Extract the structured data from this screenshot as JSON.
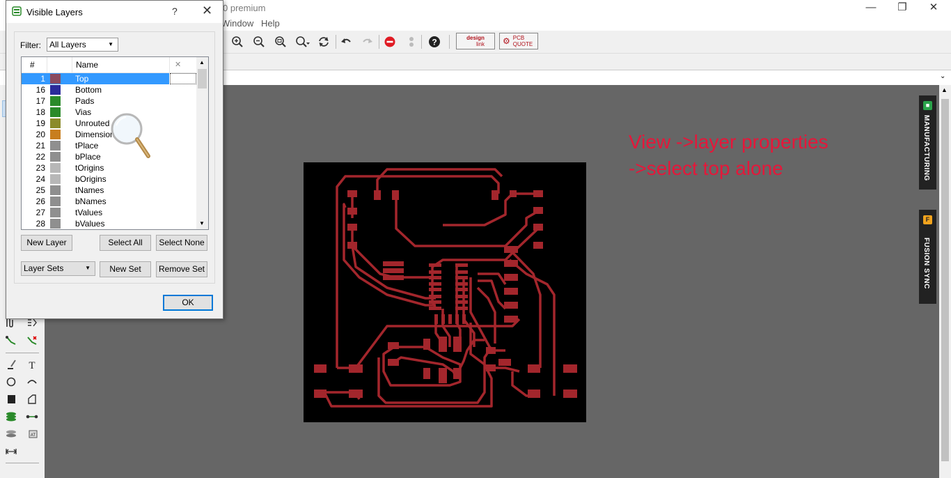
{
  "app": {
    "title": "0 premium"
  },
  "menu": {
    "window": "Window",
    "help": "Help"
  },
  "toolbar": {
    "icons": [
      "zoom-in-icon",
      "zoom-out-icon",
      "zoom-fit-icon",
      "zoom-select-icon",
      "refresh-icon",
      "undo-icon",
      "redo-icon",
      "stop-icon",
      "pause-icon",
      "help-icon"
    ],
    "design_link": [
      "design",
      "link"
    ],
    "pcb_quote": [
      "PCB",
      "QUOTE"
    ]
  },
  "annotation": {
    "line1": "View ->layer properties",
    "line2": "->select top alone"
  },
  "side_tabs": {
    "manufacturing": "MANUFACTURING",
    "fusion_sync": "FUSION SYNC"
  },
  "dialog": {
    "title": "Visible Layers",
    "help": "?",
    "close": "✕",
    "filter_label": "Filter:",
    "filter_value": "All Layers",
    "columns": {
      "num": "#",
      "name": "Name",
      "clear": "✕"
    },
    "layers": [
      {
        "num": "1",
        "name": "Top",
        "color": "#8b4a5e",
        "selected": true
      },
      {
        "num": "16",
        "name": "Bottom",
        "color": "#2b2b9a"
      },
      {
        "num": "17",
        "name": "Pads",
        "color": "#2a8a2a"
      },
      {
        "num": "18",
        "name": "Vias",
        "color": "#2a8a2a"
      },
      {
        "num": "19",
        "name": "Unrouted",
        "color": "#8b8b2a"
      },
      {
        "num": "20",
        "name": "Dimension",
        "color": "#c87e1e"
      },
      {
        "num": "21",
        "name": "tPlace",
        "color": "#8f8f8f"
      },
      {
        "num": "22",
        "name": "bPlace",
        "color": "#8f8f8f"
      },
      {
        "num": "23",
        "name": "tOrigins",
        "color": "#b7b7b7"
      },
      {
        "num": "24",
        "name": "bOrigins",
        "color": "#b7b7b7"
      },
      {
        "num": "25",
        "name": "tNames",
        "color": "#8f8f8f"
      },
      {
        "num": "26",
        "name": "bNames",
        "color": "#8f8f8f"
      },
      {
        "num": "27",
        "name": "tValues",
        "color": "#8f8f8f"
      },
      {
        "num": "28",
        "name": "bValues",
        "color": "#8f8f8f"
      }
    ],
    "buttons": {
      "new_layer": "New Layer",
      "select_all": "Select All",
      "select_none": "Select None",
      "layer_sets": "Layer Sets",
      "new_set": "New Set",
      "remove_set": "Remove Set",
      "ok": "OK"
    }
  },
  "colors": {
    "trace": "#a3262c",
    "board": "#000000",
    "canvas": "#666666",
    "selection": "#3399ff",
    "annotation": "#e5173a"
  }
}
